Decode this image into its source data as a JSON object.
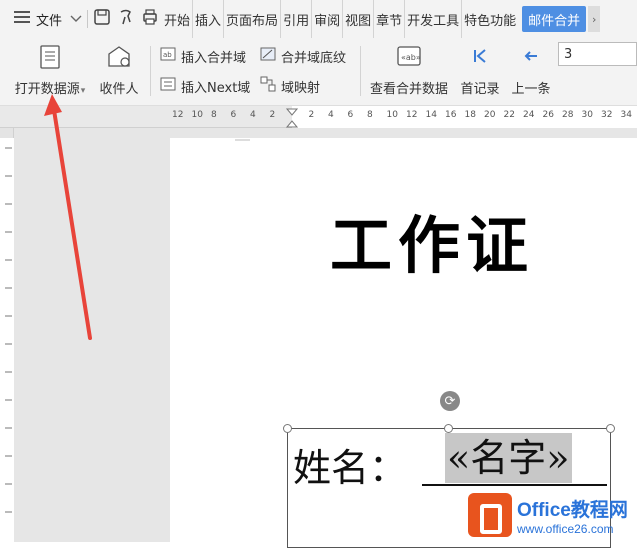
{
  "menubar": {
    "menu_label": "文件",
    "tabs": [
      "开始",
      "插入",
      "页面布局",
      "引用",
      "审阅",
      "视图",
      "章节",
      "开发工具",
      "特色功能"
    ],
    "active_tab": "邮件合并"
  },
  "ribbon": {
    "open_datasource": "打开数据源",
    "recipients": "收件人",
    "insert_merge_field": "插入合并域",
    "merge_field_shading": "合并域底纹",
    "insert_next_field": "插入Next域",
    "field_mapping": "域映射",
    "view_merged_data": "查看合并数据",
    "first_record": "首记录",
    "prev_record": "上一条",
    "record_number": "3"
  },
  "ruler": {
    "ticks": [
      "12",
      "10",
      "8",
      "6",
      "4",
      "2",
      "",
      "2",
      "4",
      "6",
      "8",
      "10",
      "12",
      "14",
      "16",
      "18",
      "20",
      "22",
      "24",
      "26",
      "28",
      "30",
      "32",
      "34"
    ]
  },
  "document": {
    "title": "工作证",
    "name_label": "姓名：",
    "merge_field": "«名字»"
  },
  "watermark": {
    "brand": "Office教程网",
    "url": "www.office26.com"
  },
  "colors": {
    "accent": "#4e8fe3",
    "arrow": "#e8443a",
    "brand": "#e8541e"
  }
}
